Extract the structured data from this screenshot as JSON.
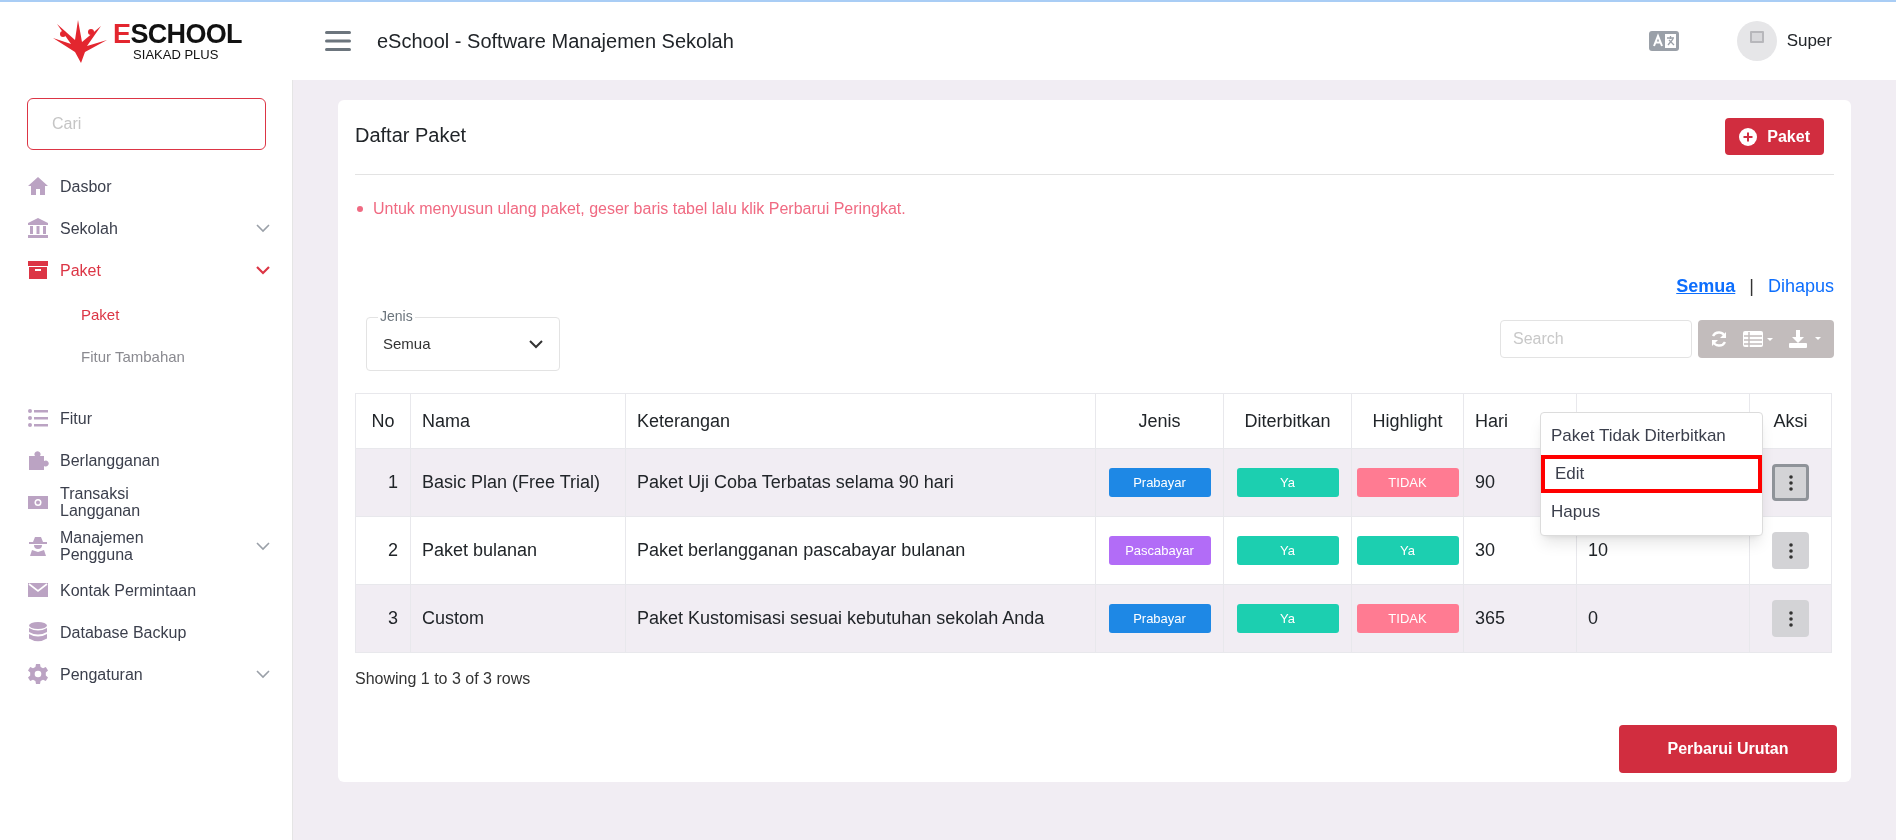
{
  "logo": {
    "name": "ESCHOOL",
    "tagline": "SIAKAD PLUS"
  },
  "header": {
    "title": "eSchool - Software Manajemen Sekolah",
    "user": "Super"
  },
  "sidebar": {
    "search": {
      "placeholder": "Cari"
    },
    "items": [
      {
        "label": "Dasbor",
        "selected": false,
        "has_submenu": false
      },
      {
        "label": "Sekolah",
        "selected": false,
        "has_submenu": true,
        "expanded": false
      },
      {
        "label": "Paket",
        "selected": true,
        "has_submenu": true,
        "expanded": true,
        "children": [
          {
            "label": "Paket",
            "selected": true
          },
          {
            "label": "Fitur Tambahan",
            "selected": false
          }
        ]
      },
      {
        "label": "Fitur",
        "selected": false,
        "has_submenu": false
      },
      {
        "label": "Berlangganan",
        "selected": false,
        "has_submenu": false
      },
      {
        "label": "Transaksi Langganan",
        "selected": false,
        "has_submenu": false
      },
      {
        "label": "Manajemen Pengguna",
        "selected": false,
        "has_submenu": true,
        "expanded": false
      },
      {
        "label": "Kontak Permintaan",
        "selected": false,
        "has_submenu": false
      },
      {
        "label": "Database Backup",
        "selected": false,
        "has_submenu": false
      },
      {
        "label": "Pengaturan",
        "selected": false,
        "has_submenu": true,
        "expanded": false
      }
    ]
  },
  "card": {
    "title": "Daftar Paket",
    "add_button": "Paket",
    "notice": "Untuk menyusun ulang paket, geser baris tabel lalu klik Perbarui Peringkat.",
    "views": [
      {
        "label": "Semua",
        "selected": true
      },
      {
        "label": "Dihapus",
        "selected": false
      }
    ],
    "views_separator": "|",
    "filter": {
      "label": "Jenis",
      "value": "Semua"
    },
    "search": {
      "placeholder": "Search"
    },
    "table": {
      "columns": [
        {
          "label": "No"
        },
        {
          "label": "Nama"
        },
        {
          "label": "Keterangan"
        },
        {
          "label": "Jenis"
        },
        {
          "label": "Diterbitkan"
        },
        {
          "label": "Highlight"
        },
        {
          "label": "Hari"
        },
        {},
        {
          "label": "Aksi"
        }
      ],
      "rows": [
        {
          "no": "1",
          "nama": "Basic Plan (Free Trial)",
          "keterangan": "Paket Uji Coba Terbatas selama 90 hari",
          "jenis": {
            "text": "Prabayar",
            "color": "#1e88e5"
          },
          "diterbitkan": {
            "text": "Ya",
            "color": "#1ccfb0"
          },
          "highlight": {
            "text": "TIDAK",
            "color": "#ff7b92"
          },
          "hari": "90",
          "action_focused": true
        },
        {
          "no": "2",
          "nama": "Paket bulanan",
          "keterangan": "Paket berlangganan pascabayar bulanan",
          "jenis": {
            "text": "Pascabayar",
            "color": "#b26cf7"
          },
          "diterbitkan": {
            "text": "Ya",
            "color": "#1ccfb0"
          },
          "highlight": {
            "text": "Ya",
            "color": "#1ccfb0"
          },
          "hari": "30",
          "column_8": "10",
          "action_focused": false
        },
        {
          "no": "3",
          "nama": "Custom",
          "keterangan": "Paket Kustomisasi sesuai kebutuhan sekolah Anda",
          "jenis": {
            "text": "Prabayar",
            "color": "#1e88e5"
          },
          "diterbitkan": {
            "text": "Ya",
            "color": "#1ccfb0"
          },
          "highlight": {
            "text": "TIDAK",
            "color": "#ff7b92"
          },
          "hari": "365",
          "column_8": "0",
          "action_focused": false
        }
      ]
    },
    "action_menu": {
      "items": [
        {
          "label": "Paket Tidak Diterbitkan",
          "highlighted": false
        },
        {
          "label": "Edit",
          "highlighted": true
        },
        {
          "label": "Hapus",
          "highlighted": false
        }
      ]
    },
    "footer_text": "Showing 1 to 3 of 3 rows",
    "save_button": "Perbarui Urutan"
  }
}
